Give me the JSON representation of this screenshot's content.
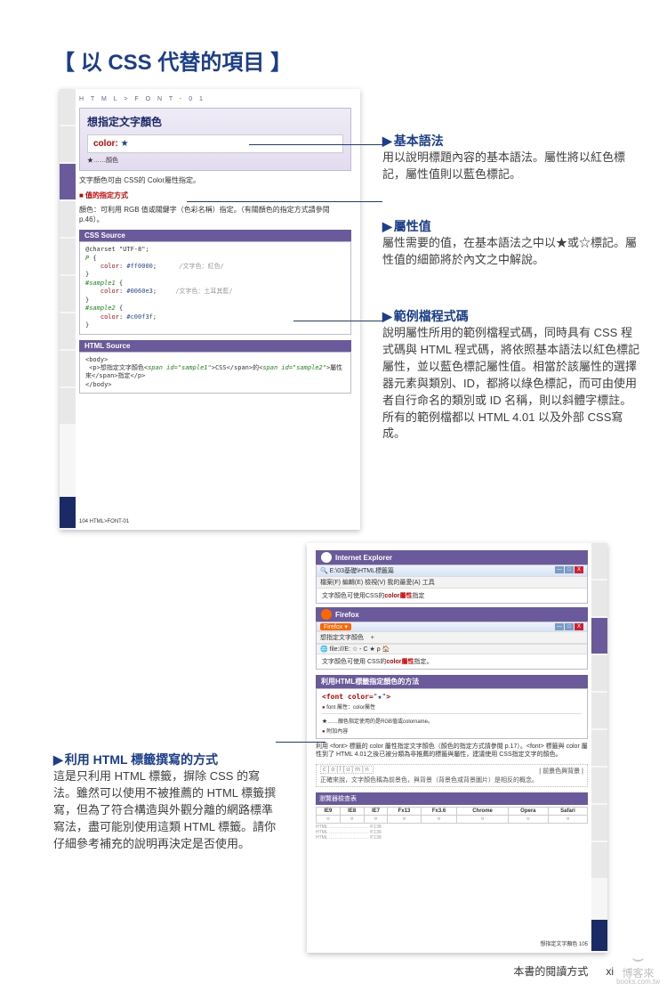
{
  "title": "【 以 CSS 代替的項目 】",
  "top_page": {
    "breadcrumb": "H T M L > F O N T - 0 1",
    "property_title": "想指定文字顏色",
    "syntax_prop": "color:",
    "syntax_star": "★",
    "legend": "★……顏色",
    "desc1": "文字顏色可由 CSS的 Color屬性指定。",
    "sec_title": "■ 值的指定方式",
    "desc2": "顏色：可利用 RGB 值或關鍵字（色彩名稱）指定。（有關顏色的指定方式請參閱 p.46）。",
    "css_hdr": "CSS Source",
    "css_code": {
      "l1": "@charset \"UTF-8\";",
      "l2": "P {",
      "l3": "    color: #ff0000;        /文字色：紅色/",
      "l4": "}",
      "l5": "#sample1 {",
      "l6": "    color: #0060e3;        /文字色：土耳其藍/",
      "l7": "}",
      "l8": "#sample2 {",
      "l9": "    color: #c00f3f;",
      "l10": "}"
    },
    "html_hdr": "HTML Source",
    "html_code": "<body>\n <p>想指定文字顏色<span id=\"sample1\">CSS</span>的<span id=\"sample2\">屬性來</span>指定</p>\n</body>",
    "footer": "104   HTML>FONT-01"
  },
  "bottom_page": {
    "ie_label": "Internet Explorer",
    "ie_addr": "E:\\03基礎\\HTML標籤篇",
    "ie_menu": "檔案(F)  編輯(E)  檢視(V)  我的最愛(A)  工具  ",
    "ie_content_a": "文字顏色可使用CSS的",
    "ie_content_b": "color屬性",
    "ie_content_c": "指定",
    "fx_label": "Firefox",
    "fx_tab": "想指定文字顏色",
    "fx_url": "file:///E:  ☆ - C  ★ ρ",
    "fx_content_a": "文字顏色可使用 CSS的",
    "fx_content_b": "color屬性",
    "fx_content_c": "指定。",
    "html_way_hdr": "利用HTML標籤指定顏色的方法",
    "font_tag": "<font color=\"★\">",
    "font_legend_a": "font 屬性：color屬性",
    "font_legend_b": "★……顏色指定使用的是RGB值或colorname。",
    "font_legend_c": "附加內容",
    "remark": "利用 <font> 標籤的 color 屬性指定文字顏色（顏色的指定方式請參閱 p.17）。<font> 標籤與 color 屬性到了 HTML 4.01之後已被分類為非推薦的標籤與屬性，建議使用 CSS指定文字的顏色。",
    "column_title": "c|o|l|u|m|n",
    "column_heading": "| 前景色與背景 |",
    "column_text": "正確來說，文字顏色稱為前景色，與背景（背景色或背景圖片）是相反的概念。",
    "check_hdr": "瀏覽器檢查表",
    "browsers": [
      "IE9",
      "IE8",
      "IE7",
      "Fx13",
      "Fx3.6",
      "Chrome",
      "Opera",
      "Safari"
    ],
    "marks": [
      "○",
      "○",
      "○",
      "○",
      "○",
      "○",
      "○",
      "○"
    ],
    "foot_r": "想指定文字顏色   105"
  },
  "callouts": {
    "c1_title": "基本語法",
    "c1_body": "用以說明標題內容的基本語法。屬性將以紅色標記，屬性值則以藍色標記。",
    "c2_title": "屬性值",
    "c2_body": "屬性需要的值，在基本語法之中以★或☆標記。屬性值的細節將於內文之中解說。",
    "c3_title": "範例檔程式碼",
    "c3_body": "說明屬性所用的範例檔程式碼，同時具有 CSS 程式碼與 HTML 程式碼，將依照基本語法以紅色標記屬性，並以藍色標記屬性值。相當於該屬性的選擇器元素與類別、ID，都將以綠色標記，而可由使用者自行命名的類別或 ID 名稱，則以斜體字標註。所有的範例檔都以 HTML 4.01 以及外部 CSS寫成。",
    "c4_title": "利用 HTML 標籤撰寫的方式",
    "c4_body": "這是只利用 HTML 標籤，摒除 CSS 的寫法。雖然可以使用不被推薦的 HTML 標籤撰寫，但為了符合構造與外觀分離的網路標準寫法，盡可能別使用這類 HTML 標籤。請你仔細參考補充的說明再決定是否使用。"
  },
  "footer": {
    "label": "本書的閱讀方式",
    "page": "xi"
  },
  "watermark": {
    "name": "博客來",
    "url": "books.com.tw"
  }
}
